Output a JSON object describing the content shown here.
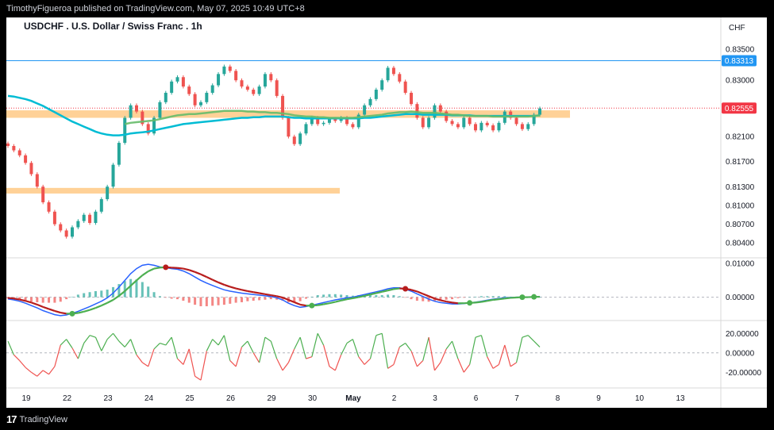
{
  "header": {
    "published": "TimothyFigueroa published on TradingView.com, May 07, 2025 10:49 UTC+8"
  },
  "footer": {
    "brand": "TradingView",
    "logo_icon": "tradingview-logo-icon"
  },
  "chart_data": {
    "type": "candlestick",
    "title": "USDCHF . U.S. Dollar / Swiss Franc . 1h",
    "currency": "CHF",
    "x_ticks": [
      "19",
      "22",
      "23",
      "24",
      "25",
      "26",
      "29",
      "30",
      "May",
      "2",
      "3",
      "6",
      "7",
      "8",
      "9",
      "10",
      "13"
    ],
    "price_ticks": [
      "0.83500",
      "0.83000",
      "0.82100",
      "0.81700",
      "0.81300",
      "0.81000",
      "0.80700",
      "0.80400"
    ],
    "price_range": [
      0.802,
      0.837
    ],
    "tags": {
      "resistance_line": "0.83313",
      "last_price": "0.82555"
    },
    "resistance_level": 0.83313,
    "last_price": 0.82555,
    "zones": [
      {
        "from": 0.824,
        "to": 0.8252,
        "label": ""
      },
      {
        "from": 0.8119,
        "to": 0.8128,
        "label": ""
      }
    ],
    "colors": {
      "up": "#26a69a",
      "down": "#ef5350",
      "ma": "#00bcd4",
      "ema": "#66bb6a",
      "zone": "#ffc985",
      "resistance": "#2196f3",
      "last": "#f23645"
    },
    "close": [
      0.8195,
      0.8188,
      0.818,
      0.8168,
      0.815,
      0.813,
      0.8105,
      0.809,
      0.807,
      0.806,
      0.805,
      0.8065,
      0.8075,
      0.8085,
      0.8072,
      0.809,
      0.811,
      0.813,
      0.8165,
      0.82,
      0.824,
      0.826,
      0.825,
      0.823,
      0.8215,
      0.824,
      0.8265,
      0.828,
      0.8298,
      0.8305,
      0.829,
      0.8278,
      0.826,
      0.8265,
      0.828,
      0.8292,
      0.831,
      0.8322,
      0.8315,
      0.83,
      0.829,
      0.8285,
      0.8278,
      0.829,
      0.831,
      0.83,
      0.8275,
      0.824,
      0.821,
      0.8198,
      0.8215,
      0.823,
      0.824,
      0.823,
      0.8232,
      0.8238,
      0.8235,
      0.824,
      0.823,
      0.8225,
      0.8245,
      0.826,
      0.827,
      0.8285,
      0.83,
      0.832,
      0.831,
      0.8298,
      0.828,
      0.8262,
      0.824,
      0.8225,
      0.824,
      0.826,
      0.825,
      0.8235,
      0.823,
      0.8225,
      0.824,
      0.823,
      0.822,
      0.8232,
      0.8228,
      0.822,
      0.8232,
      0.825,
      0.824,
      0.823,
      0.8222,
      0.823,
      0.8245,
      0.8255
    ],
    "ma_slow": [
      0.8275,
      0.8274,
      0.8272,
      0.827,
      0.8267,
      0.8263,
      0.8259,
      0.8254,
      0.8249,
      0.8244,
      0.8239,
      0.8234,
      0.823,
      0.8226,
      0.8222,
      0.8218,
      0.8215,
      0.8213,
      0.8212,
      0.8212,
      0.8213,
      0.8215,
      0.8216,
      0.8217,
      0.8218,
      0.822,
      0.8222,
      0.8224,
      0.8226,
      0.8228,
      0.823,
      0.8231,
      0.8232,
      0.8233,
      0.8234,
      0.8235,
      0.8236,
      0.8237,
      0.8238,
      0.8239,
      0.824,
      0.824,
      0.8241,
      0.8241,
      0.8242,
      0.8242,
      0.8242,
      0.8242,
      0.8241,
      0.824,
      0.824,
      0.8239,
      0.8239,
      0.8239,
      0.8239,
      0.8239,
      0.8239,
      0.8239,
      0.8239,
      0.8239,
      0.8239,
      0.824,
      0.824,
      0.8241,
      0.8242,
      0.8243,
      0.8244,
      0.8245,
      0.8246,
      0.8246,
      0.8246,
      0.8245,
      0.8245,
      0.8245,
      0.8245,
      0.8245,
      0.8244,
      0.8244,
      0.8244,
      0.8244,
      0.8243,
      0.8243,
      0.8243,
      0.8243,
      0.8243,
      0.8243,
      0.8243,
      0.8243,
      0.8243,
      0.8243,
      0.8243,
      0.8244
    ],
    "ema_start_index": 20,
    "ema": [
      0.823,
      0.8232,
      0.8233,
      0.8234,
      0.8235,
      0.8236,
      0.8238,
      0.824,
      0.8242,
      0.8244,
      0.8245,
      0.8246,
      0.8246,
      0.8247,
      0.8248,
      0.8249,
      0.825,
      0.8251,
      0.8251,
      0.8251,
      0.8251,
      0.825,
      0.825,
      0.8249,
      0.8249,
      0.8248,
      0.8248,
      0.8247,
      0.8246,
      0.8244,
      0.8243,
      0.8242,
      0.8242,
      0.8241,
      0.8241,
      0.824,
      0.824,
      0.824,
      0.824,
      0.824,
      0.8241,
      0.8242,
      0.8243,
      0.8244,
      0.8245,
      0.8247,
      0.8248,
      0.8249,
      0.8249,
      0.825,
      0.8249,
      0.8248,
      0.8248,
      0.8248,
      0.8247,
      0.8246,
      0.8245,
      0.8245,
      0.8244,
      0.8243,
      0.8243,
      0.8243,
      0.8243,
      0.8242,
      0.8242,
      0.8242,
      0.8242,
      0.8242,
      0.8242,
      0.8242,
      0.8243,
      0.8244
    ],
    "macd": {
      "ticks": [
        "0.01000",
        "0.00000"
      ],
      "range": [
        -0.006,
        0.011
      ],
      "macd": [
        -0.0005,
        -0.0008,
        -0.0012,
        -0.0018,
        -0.0025,
        -0.0032,
        -0.004,
        -0.0046,
        -0.0052,
        -0.0055,
        -0.0053,
        -0.0048,
        -0.0042,
        -0.0035,
        -0.0028,
        -0.002,
        -0.0012,
        -0.0002,
        0.0012,
        0.003,
        0.005,
        0.007,
        0.0085,
        0.0095,
        0.0098,
        0.0095,
        0.009,
        0.0088,
        0.0085,
        0.0083,
        0.0078,
        0.007,
        0.006,
        0.005,
        0.0042,
        0.0035,
        0.0028,
        0.0022,
        0.0018,
        0.0015,
        0.0012,
        0.001,
        0.0008,
        0.0006,
        0.0004,
        0.0002,
        -0.0002,
        -0.0008,
        -0.0018,
        -0.0025,
        -0.003,
        -0.0028,
        -0.0024,
        -0.002,
        -0.0016,
        -0.0012,
        -0.0008,
        -0.0005,
        -0.0002,
        0.0,
        0.0004,
        0.0008,
        0.0012,
        0.0016,
        0.002,
        0.0025,
        0.0028,
        0.0028,
        0.0024,
        0.0018,
        0.001,
        0.0002,
        -0.0006,
        -0.0012,
        -0.0016,
        -0.0018,
        -0.002,
        -0.002,
        -0.0019,
        -0.0017,
        -0.0015,
        -0.0012,
        -0.0009,
        -0.0006,
        -0.0004,
        -0.0002,
        -0.0001,
        0.0,
        0.0,
        0.0001,
        0.0001,
        0.0002
      ],
      "signal": [
        -0.0002,
        -0.0004,
        -0.0007,
        -0.0011,
        -0.0016,
        -0.0022,
        -0.0029,
        -0.0035,
        -0.0041,
        -0.0046,
        -0.0049,
        -0.0049,
        -0.0047,
        -0.0043,
        -0.0038,
        -0.0032,
        -0.0025,
        -0.0017,
        -0.0008,
        0.0004,
        0.0018,
        0.0034,
        0.005,
        0.0065,
        0.0077,
        0.0085,
        0.0088,
        0.0089,
        0.0088,
        0.0087,
        0.0085,
        0.0081,
        0.0075,
        0.0068,
        0.006,
        0.0052,
        0.0044,
        0.0037,
        0.0031,
        0.0026,
        0.0022,
        0.0018,
        0.0015,
        0.0012,
        0.0009,
        0.0006,
        0.0003,
        -0.0001,
        -0.0008,
        -0.0015,
        -0.0022,
        -0.0025,
        -0.0025,
        -0.0024,
        -0.0021,
        -0.0018,
        -0.0014,
        -0.001,
        -0.0006,
        -0.0003,
        0.0,
        0.0004,
        0.0008,
        0.0012,
        0.0016,
        0.002,
        0.0024,
        0.0026,
        0.0025,
        0.0022,
        0.0017,
        0.001,
        0.0003,
        -0.0004,
        -0.0009,
        -0.0013,
        -0.0016,
        -0.0018,
        -0.0018,
        -0.0017,
        -0.0016,
        -0.0014,
        -0.0011,
        -0.0008,
        -0.0006,
        -0.0004,
        -0.0002,
        -0.0001,
        0.0,
        0.0,
        0.0001,
        0.0001
      ]
    },
    "rsi": {
      "ticks": [
        "20.00000",
        "0.00000",
        "-20.00000"
      ],
      "range": [
        -32,
        30
      ],
      "values": [
        12,
        -2,
        -8,
        -15,
        -20,
        -24,
        -18,
        -22,
        -14,
        8,
        14,
        5,
        -6,
        10,
        18,
        16,
        2,
        14,
        20,
        12,
        6,
        14,
        -2,
        -10,
        -14,
        4,
        10,
        8,
        16,
        -6,
        -12,
        4,
        -24,
        -28,
        2,
        14,
        8,
        18,
        -8,
        -14,
        6,
        12,
        0,
        -10,
        16,
        12,
        -6,
        -18,
        -10,
        4,
        16,
        -6,
        -4,
        20,
        8,
        -14,
        -18,
        -2,
        10,
        14,
        -4,
        -12,
        -6,
        18,
        20,
        -16,
        -12,
        6,
        10,
        2,
        -14,
        -8,
        16,
        -18,
        -10,
        4,
        12,
        -6,
        -20,
        -12,
        16,
        18,
        -4,
        -16,
        -12,
        8,
        -14,
        -10,
        16,
        18,
        12,
        6
      ]
    }
  }
}
